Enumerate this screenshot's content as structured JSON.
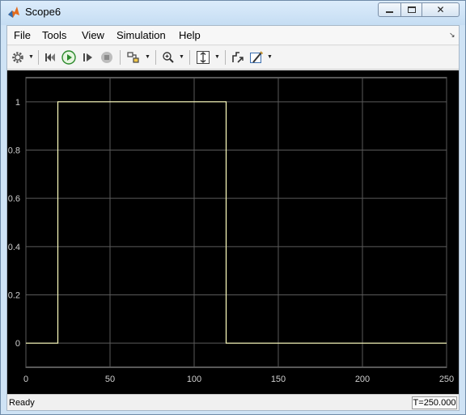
{
  "window": {
    "title": "Scope6"
  },
  "menu": [
    "File",
    "Tools",
    "View",
    "Simulation",
    "Help"
  ],
  "toolbar": {
    "icons": [
      "gear-icon",
      "step-back-icon",
      "run-icon",
      "step-forward-icon",
      "stop-icon",
      "highlight-block-icon",
      "zoom-icon",
      "autoscale-icon",
      "signal-select-icon",
      "style-icon"
    ]
  },
  "colors": {
    "plot_background": "#000000",
    "axes_background": "#000000",
    "grid": "#5a5a5a",
    "signal": "#ffffbf",
    "tick_text": "#cfcfcf"
  },
  "chart_data": {
    "type": "line",
    "title": "",
    "xlabel": "",
    "ylabel": "",
    "xlim": [
      0,
      250
    ],
    "ylim": [
      -0.1,
      1.1
    ],
    "xticks": [
      0,
      50,
      100,
      150,
      200,
      250
    ],
    "xtick_labels": [
      "0",
      "50",
      "100",
      "150",
      "200",
      "250"
    ],
    "yticks": [
      0,
      0.2,
      0.4,
      0.6,
      0.8,
      1
    ],
    "ytick_labels": [
      "0",
      "0.2",
      "0.4",
      "0.6",
      "0.8",
      "1"
    ],
    "grid": true,
    "series": [
      {
        "x": [
          0,
          19,
          19,
          119,
          119,
          250
        ],
        "values": [
          0,
          0,
          1,
          1,
          0,
          0
        ]
      }
    ]
  },
  "status": {
    "text": "Ready",
    "time": "T=250.000"
  }
}
